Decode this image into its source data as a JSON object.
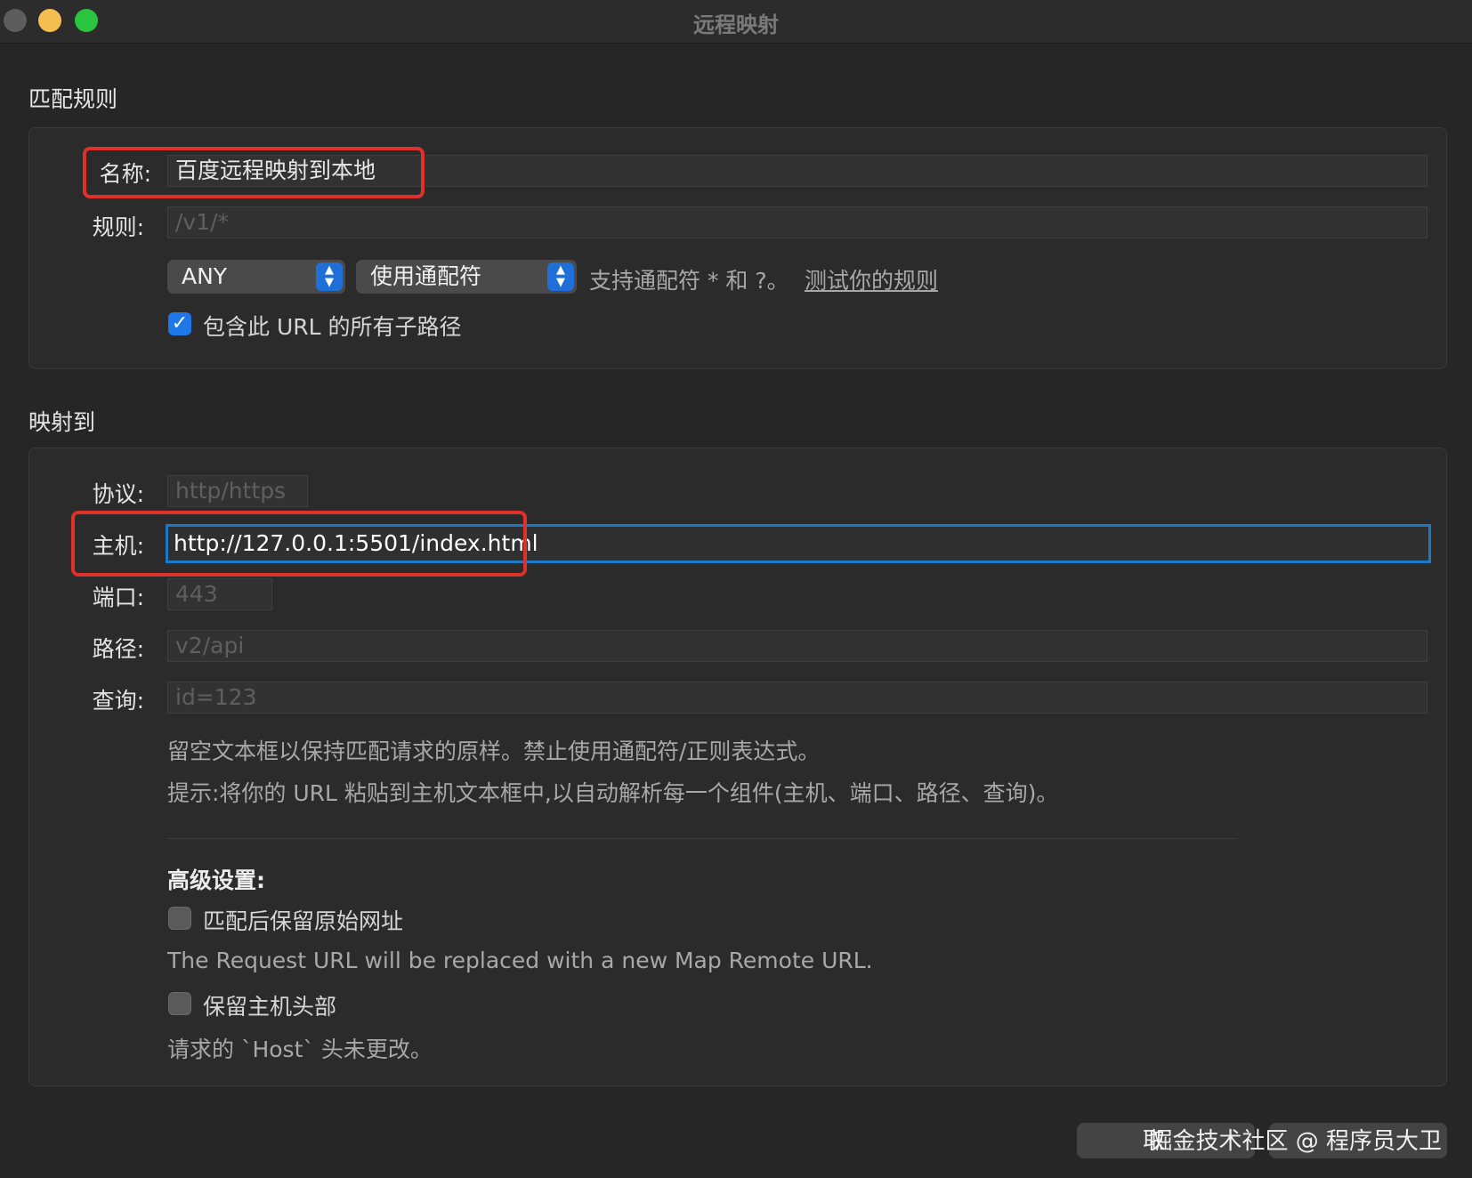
{
  "window": {
    "title": "远程映射"
  },
  "match_rule": {
    "section_title": "匹配规则",
    "name_label": "名称:",
    "name_value": "百度远程映射到本地",
    "rule_label": "规则:",
    "rule_placeholder": "/v1/*",
    "method_select": "ANY",
    "match_type_select": "使用通配符",
    "wildcard_hint": "支持通配符 * 和 ?。",
    "test_rule_link": "测试你的规则",
    "include_subpaths_label": "包含此 URL 的所有子路径",
    "include_subpaths_checked": true
  },
  "map_to": {
    "section_title": "映射到",
    "protocol_label": "协议:",
    "protocol_placeholder": "http/https",
    "host_label": "主机:",
    "host_value": "http://127.0.0.1:5501/index.html",
    "port_label": "端口:",
    "port_placeholder": "443",
    "path_label": "路径:",
    "path_placeholder": "v2/api",
    "query_label": "查询:",
    "query_placeholder": "id=123",
    "note1": "留空文本框以保持匹配请求的原样。禁止使用通配符/正则表达式。",
    "note2": "提示:将你的 URL 粘贴到主机文本框中,以自动解析每一个组件(主机、端口、路径、查询)。",
    "advanced_title": "高级设置:",
    "preserve_url_label": "匹配后保留原始网址",
    "preserve_url_checked": false,
    "preserve_url_desc": "The Request URL will be replaced with a new Map Remote URL.",
    "preserve_host_label": "保留主机头部",
    "preserve_host_checked": false,
    "preserve_host_desc": "请求的 `Host` 头未更改。"
  },
  "footer": {
    "cancel_label": "取",
    "watermark": "掘金技术社区 @ 程序员大卫"
  },
  "colors": {
    "accent": "#1e78e8",
    "highlight": "#e0302a",
    "background": "#262626"
  }
}
